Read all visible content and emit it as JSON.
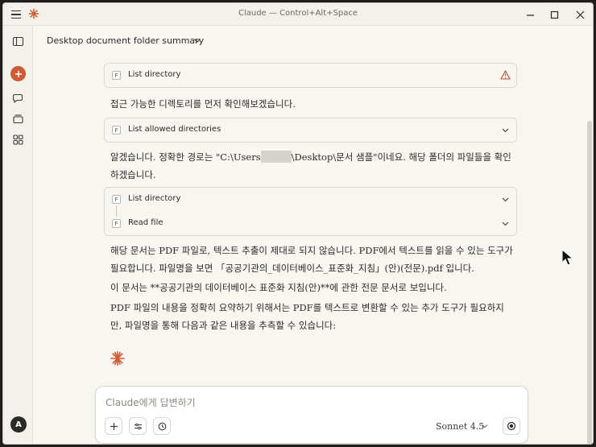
{
  "window": {
    "title": "Claude — Control+Alt+Space"
  },
  "header": {
    "chat_title": "Desktop document folder summary"
  },
  "thread": {
    "tool1": {
      "badge": "F",
      "label": "List directory"
    },
    "msg1": "접근 가능한 디렉토리를 먼저 확인해보겠습니다.",
    "tool2": {
      "badge": "F",
      "label": "List allowed directories"
    },
    "msg2_before": "알겠습니다. 정확한 경로는 \"C:\\Users",
    "msg2_after": "\\Desktop\\문서 샘플\"이네요. 해당 폴더의 파일들을 확인하겠습니다.",
    "tool3a": {
      "badge": "F",
      "label": "List directory"
    },
    "tool3b": {
      "badge": "F",
      "label": "Read file"
    },
    "msg3": "해당 문서는 PDF 파일로, 텍스트 추출이 제대로 되지 않습니다. PDF에서 텍스트를 읽을 수 있는 도구가 필요합니다. 파일명을 보면 「공공기관의_데이터베이스_표준화_지침」(안)(전문).pdf 입니다.",
    "msg4": "이 문서는 **공공기관의 데이터베이스 표준화 지침(안)**에 관한 전문 문서로 보입니다.",
    "msg5": "PDF 파일의 내용을 정확히 요약하기 위해서는 PDF를 텍스트로 변환할 수 있는 추가 도구가 필요하지만, 파일명을 통해 다음과 같은 내용을 추측할 수 있습니다:"
  },
  "composer": {
    "placeholder": "Claude에게 답변하기",
    "model": "Sonnet 4.5"
  },
  "sidebar": {
    "avatar_initial": "A"
  },
  "colors": {
    "accent": "#cf5a35",
    "background": "#f8f6f1"
  }
}
